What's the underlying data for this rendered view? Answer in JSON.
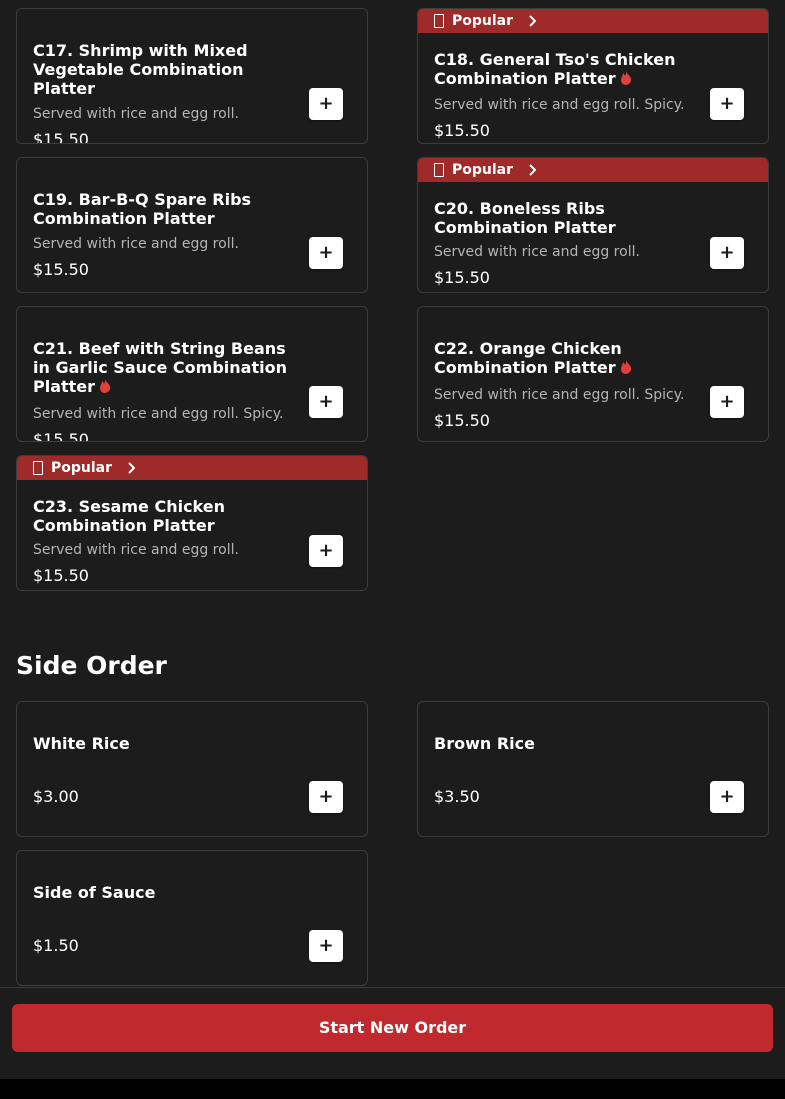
{
  "banner_label": "Popular",
  "add_label": "+",
  "menu_items": [
    {
      "title": "C17. Shrimp with Mixed Vegetable Combination Platter",
      "desc": "Served with rice and egg roll.",
      "price": "$15.50"
    },
    {
      "title": "C18. General Tso's Chicken Combination Platter",
      "desc": "Served with rice and egg roll. Spicy.",
      "price": "$15.50",
      "popular": true,
      "spicy": true
    },
    {
      "title": "C19. Bar-B-Q Spare Ribs Combination Platter",
      "desc": "Served with rice and egg roll.",
      "price": "$15.50"
    },
    {
      "title": "C20. Boneless Ribs Combination Platter",
      "desc": "Served with rice and egg roll.",
      "price": "$15.50",
      "popular": true
    },
    {
      "title": "C21. Beef with String Beans in Garlic Sauce Combination Platter",
      "desc": "Served with rice and egg roll. Spicy.",
      "price": "$15.50",
      "spicy": true
    },
    {
      "title": "C22. Orange Chicken Combination Platter",
      "desc": "Served with rice and egg roll. Spicy.",
      "price": "$15.50",
      "spicy": true
    },
    {
      "title": "C23. Sesame Chicken Combination Platter",
      "desc": "Served with rice and egg roll.",
      "price": "$15.50",
      "popular": true
    }
  ],
  "side_section": {
    "title": "Side Order",
    "items": [
      {
        "title": "White Rice",
        "price": "$3.00"
      },
      {
        "title": "Brown Rice",
        "price": "$3.50"
      },
      {
        "title": "Side of Sauce",
        "price": "$1.50"
      }
    ]
  },
  "bottom": {
    "start_order_label": "Start New Order"
  },
  "colors": {
    "accent": "#c0292d",
    "banner": "#9e2a2a",
    "spicy": "#e0403a",
    "card_border": "#3c3c3c",
    "background": "#1c1c1c"
  },
  "icons": {
    "spicy": "flame-icon",
    "popular": "popular-icon",
    "banner_arrow": "chevron-right-icon",
    "add": "plus-icon"
  }
}
